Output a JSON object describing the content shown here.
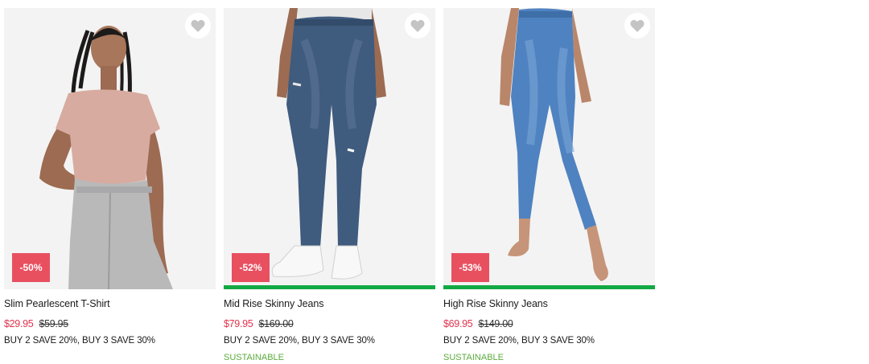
{
  "theme": {
    "sale_color": "#e0334b",
    "badge_color": "#e85060",
    "sustainable_color": "#5aac3c",
    "sustainable_bar_color": "#12a945",
    "heart_color": "#c4c4c4"
  },
  "products": [
    {
      "title": "Slim Pearlescent T-Shirt",
      "sale_price": "$29.95",
      "original_price": "$59.95",
      "discount_badge": "-50%",
      "promo": "BUY 2 SAVE 20%, BUY 3 SAVE 30%",
      "sustainable_label": "",
      "wishlist_icon": "heart-icon"
    },
    {
      "title": "Mid Rise Skinny Jeans",
      "sale_price": "$79.95",
      "original_price": "$169.00",
      "discount_badge": "-52%",
      "promo": "BUY 2 SAVE 20%, BUY 3 SAVE 30%",
      "sustainable_label": "SUSTAINABLE",
      "wishlist_icon": "heart-icon"
    },
    {
      "title": "High Rise Skinny Jeans",
      "sale_price": "$69.95",
      "original_price": "$149.00",
      "discount_badge": "-53%",
      "promo": "BUY 2 SAVE 20%, BUY 3 SAVE 30%",
      "sustainable_label": "SUSTAINABLE",
      "wishlist_icon": "heart-icon"
    }
  ]
}
